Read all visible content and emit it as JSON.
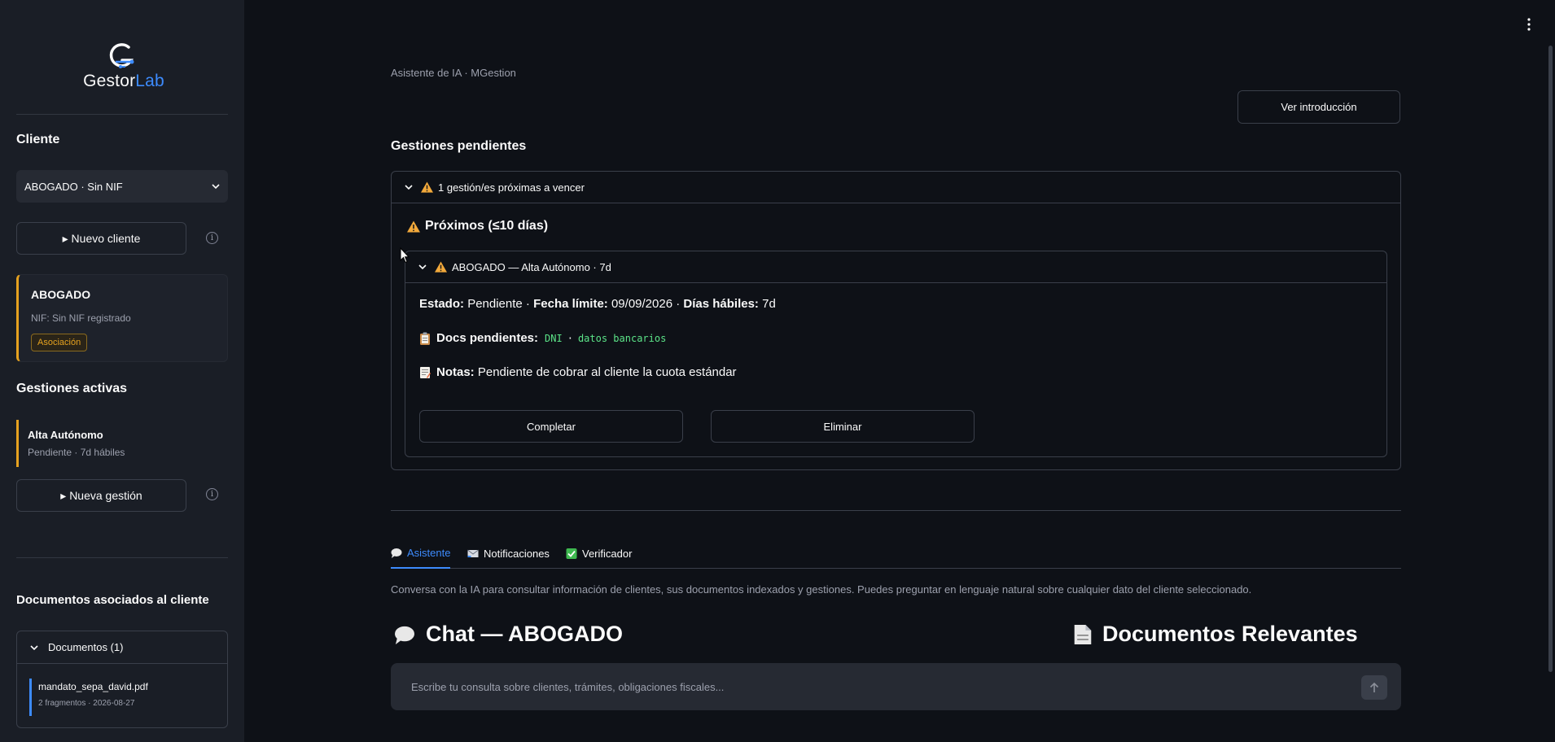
{
  "sidebar": {
    "logo_text_main": "Gestor",
    "logo_text_accent": "Lab",
    "client_heading": "Cliente",
    "client_select_value": "ABOGADO · Sin NIF",
    "new_client_button": "▸ Nuevo cliente",
    "client_card": {
      "name": "ABOGADO",
      "nif": "NIF: Sin NIF registrado",
      "tag": "Asociación"
    },
    "active_heading": "Gestiones activas",
    "active_gestion": {
      "title": "Alta Autónomo",
      "subtitle": "Pendiente · 7d hábiles"
    },
    "new_gestion_button": "▸ Nueva gestión",
    "docs_heading": "Documentos asociados al cliente",
    "docs_expander": "Documentos (1)",
    "doc": {
      "filename": "mandato_sepa_david.pdf",
      "meta": "2 fragmentos · 2026-08-27"
    }
  },
  "main": {
    "breadcrumb": "Asistente de IA · MGestion",
    "intro_button": "Ver introducción",
    "pending_title": "Gestiones pendientes",
    "pending_expander": "1 gestión/es próximas a vencer",
    "proximos_title": "Próximos (≤10 días)",
    "item_expander": "ABOGADO — Alta Autónomo · 7d",
    "estado_label": "Estado:",
    "estado_value": "Pendiente ·",
    "fecha_label": "Fecha límite:",
    "fecha_value": "09/09/2026 ·",
    "dias_label": "Días hábiles:",
    "dias_value": "7d",
    "docs_label": "Docs pendientes:",
    "doc_code_1": "DNI",
    "doc_code_sep": "·",
    "doc_code_2": "datos bancarios",
    "notas_label": "Notas:",
    "notas_value": "Pendiente de cobrar al cliente la cuota estándar",
    "complete_button": "Completar",
    "delete_button": "Eliminar",
    "tabs": [
      {
        "label": "Asistente"
      },
      {
        "label": "Notificaciones"
      },
      {
        "label": "Verificador"
      }
    ],
    "tab_description": "Conversa con la IA para consultar información de clientes, sus documentos indexados y gestiones. Puedes preguntar en lenguaje natural sobre cualquier dato del cliente seleccionado.",
    "chat_title": "Chat — ABOGADO",
    "docs_relevantes_title": "Documentos Relevantes",
    "chat_placeholder": "Escribe tu consulta sobre clientes, trámites, obligaciones fiscales..."
  },
  "colors": {
    "background": "#0e1117",
    "sidebar": "#1a1e26",
    "accent": "#3d8bfd",
    "warning": "#e6a21f",
    "code_green": "#5ce488"
  },
  "icons": [
    "gestorlab-logo-icon",
    "chevron-down-icon",
    "info-icon",
    "warning-icon",
    "clipboard-icon",
    "memo-icon",
    "speech-bubble-icon",
    "envelope-icon",
    "check-box-icon",
    "document-icon",
    "arrow-up-icon",
    "kebab-menu-icon",
    "mouse-cursor-icon"
  ]
}
